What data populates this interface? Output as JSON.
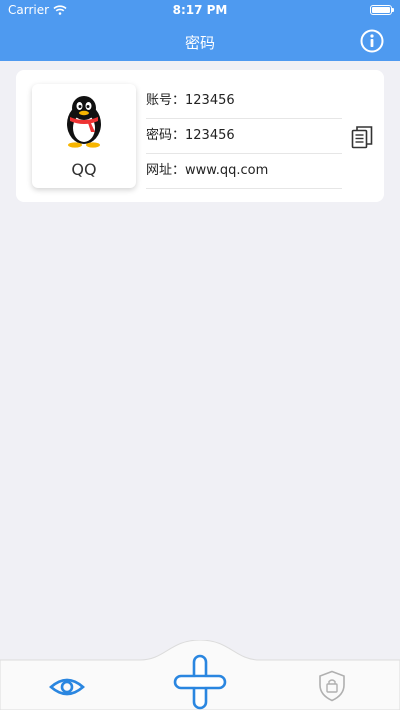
{
  "status_bar": {
    "carrier": "Carrier",
    "time": "8:17 PM"
  },
  "header": {
    "title": "密码"
  },
  "entry": {
    "app_name": "QQ",
    "account_label": "账号：",
    "account_value": "123456",
    "password_label": "密码：",
    "password_value": "123456",
    "url_label": "网址：",
    "url_value": "www.qq.com"
  },
  "icons": {
    "info": "info-icon",
    "copy": "copy-icon",
    "logo": "qq-penguin-logo",
    "eye": "eye-icon",
    "add": "add-icon",
    "lock": "shield-lock-icon"
  },
  "colors": {
    "accent": "#4e9af0",
    "background": "#f0f0f5"
  }
}
